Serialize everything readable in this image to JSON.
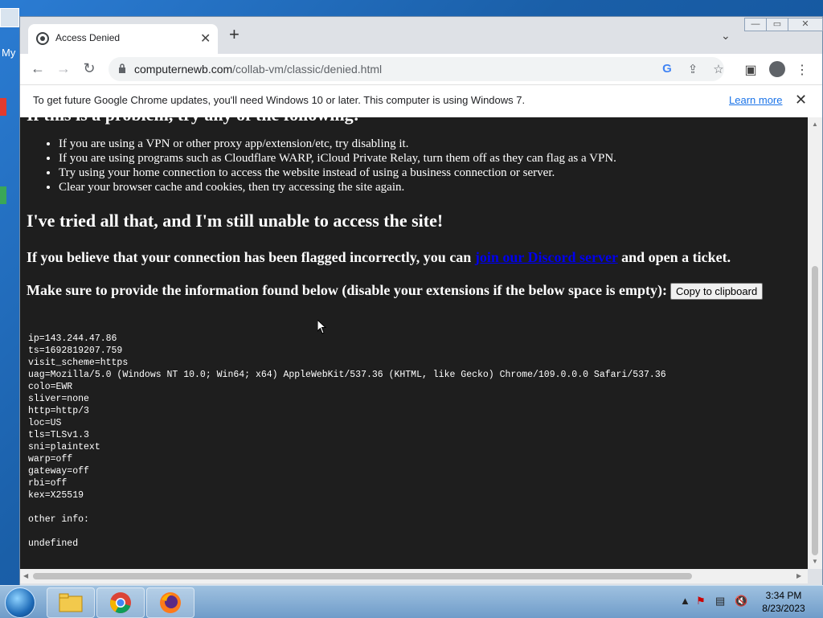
{
  "desktop": {
    "icon_label": "My"
  },
  "window": {
    "buttons": {
      "minimize": "—",
      "maximize": "▭",
      "close": "✕"
    }
  },
  "tab": {
    "title": "Access Denied",
    "close": "✕",
    "new_tab": "+"
  },
  "address_bar": {
    "url_host": "computernewb.com",
    "url_path": "/collab-vm/classic/denied.html"
  },
  "infobar": {
    "message": "To get future Google Chrome updates, you'll need Windows 10 or later. This computer is using Windows 7.",
    "link": "Learn more",
    "close": "✕"
  },
  "page": {
    "cut_heading": "If this is a problem, try any of the following:",
    "tips": [
      "If you are using a VPN or other proxy app/extension/etc, try disabling it.",
      "If you are using programs such as Cloudflare WARP, iCloud Private Relay, turn them off as they can flag as a VPN.",
      "Try using your home connection to access the website instead of using a business connection or server.",
      "Clear your browser cache and cookies, then try accessing the site again."
    ],
    "heading": "I've tried all that, and I'm still unable to access the site!",
    "flagged_before": "If you believe that your connection has been flagged incorrectly, you can ",
    "flagged_link": "join our Discord server",
    "flagged_after": " and open a ticket.",
    "provide_text": "Make sure to provide the information found below (disable your extensions if the below space is empty):",
    "copy_button": "Copy to clipboard",
    "trace": "ip=143.244.47.86\nts=1692819207.759\nvisit_scheme=https\nuag=Mozilla/5.0 (Windows NT 10.0; Win64; x64) AppleWebKit/537.36 (KHTML, like Gecko) Chrome/109.0.0.0 Safari/537.36\ncolo=EWR\nsliver=none\nhttp=http/3\nloc=US\ntls=TLSv1.3\nsni=plaintext\nwarp=off\ngateway=off\nrbi=off\nkex=X25519\n\nother info:\n\nundefined"
  },
  "taskbar": {
    "time": "3:34 PM",
    "date": "8/23/2023",
    "apps": [
      "windows-explorer",
      "google-chrome",
      "firefox"
    ]
  }
}
